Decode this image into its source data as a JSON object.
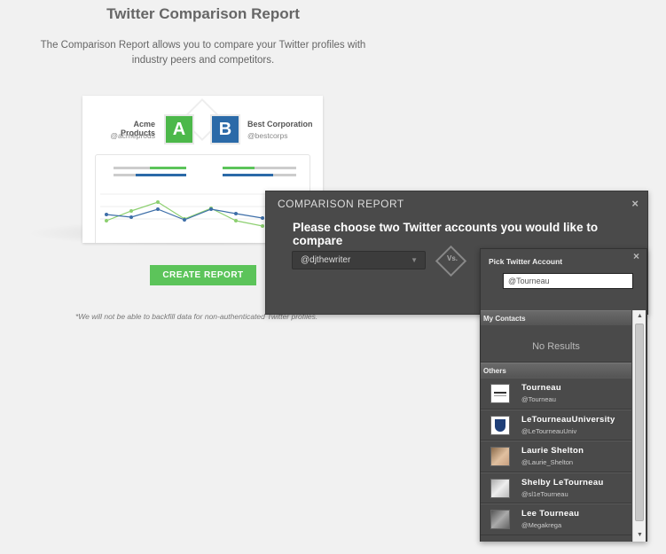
{
  "page": {
    "title": "Twitter Comparison Report",
    "description": "The Comparison Report allows you to compare your Twitter profiles with industry peers and competitors.",
    "create_button": "CREATE REPORT",
    "note": "*We will not be able to backfill data for non-authenticated Twitter profiles."
  },
  "preview": {
    "account_a": {
      "name": "Acme Products",
      "handle": "@acmeprods",
      "badge": "A"
    },
    "account_b": {
      "name": "Best Corporation",
      "handle": "@bestcorps",
      "badge": "B"
    },
    "colors": {
      "green": "#4cb84a",
      "blue": "#2b6aa8"
    }
  },
  "modal": {
    "header": "COMPARISON REPORT",
    "close": "×",
    "prompt": "Please choose two Twitter accounts you would like to compare",
    "selected_account": "@djthewriter",
    "vs_label": "Vs."
  },
  "picker": {
    "title": "Pick Twitter Account",
    "close": "×",
    "input_value": "@Tourneau",
    "my_contacts_header": "My Contacts",
    "no_results": "No Results",
    "others_header": "Others",
    "contacts": [
      {
        "name": "Tourneau",
        "handle": "@Tourneau",
        "avatar": "logo-avatar"
      },
      {
        "name": "LeTourneauUniversity",
        "handle": "@LeTourneauUniv",
        "avatar": "shield-avatar"
      },
      {
        "name": "Laurie Shelton",
        "handle": "@Laurie_Shelton",
        "avatar": "photo-avatar"
      },
      {
        "name": "Shelby LeTourneau",
        "handle": "@sl1eTourneau",
        "avatar": "photo-avatar"
      },
      {
        "name": "Lee Tourneau",
        "handle": "@Megakrega",
        "avatar": "photo-avatar"
      }
    ]
  }
}
